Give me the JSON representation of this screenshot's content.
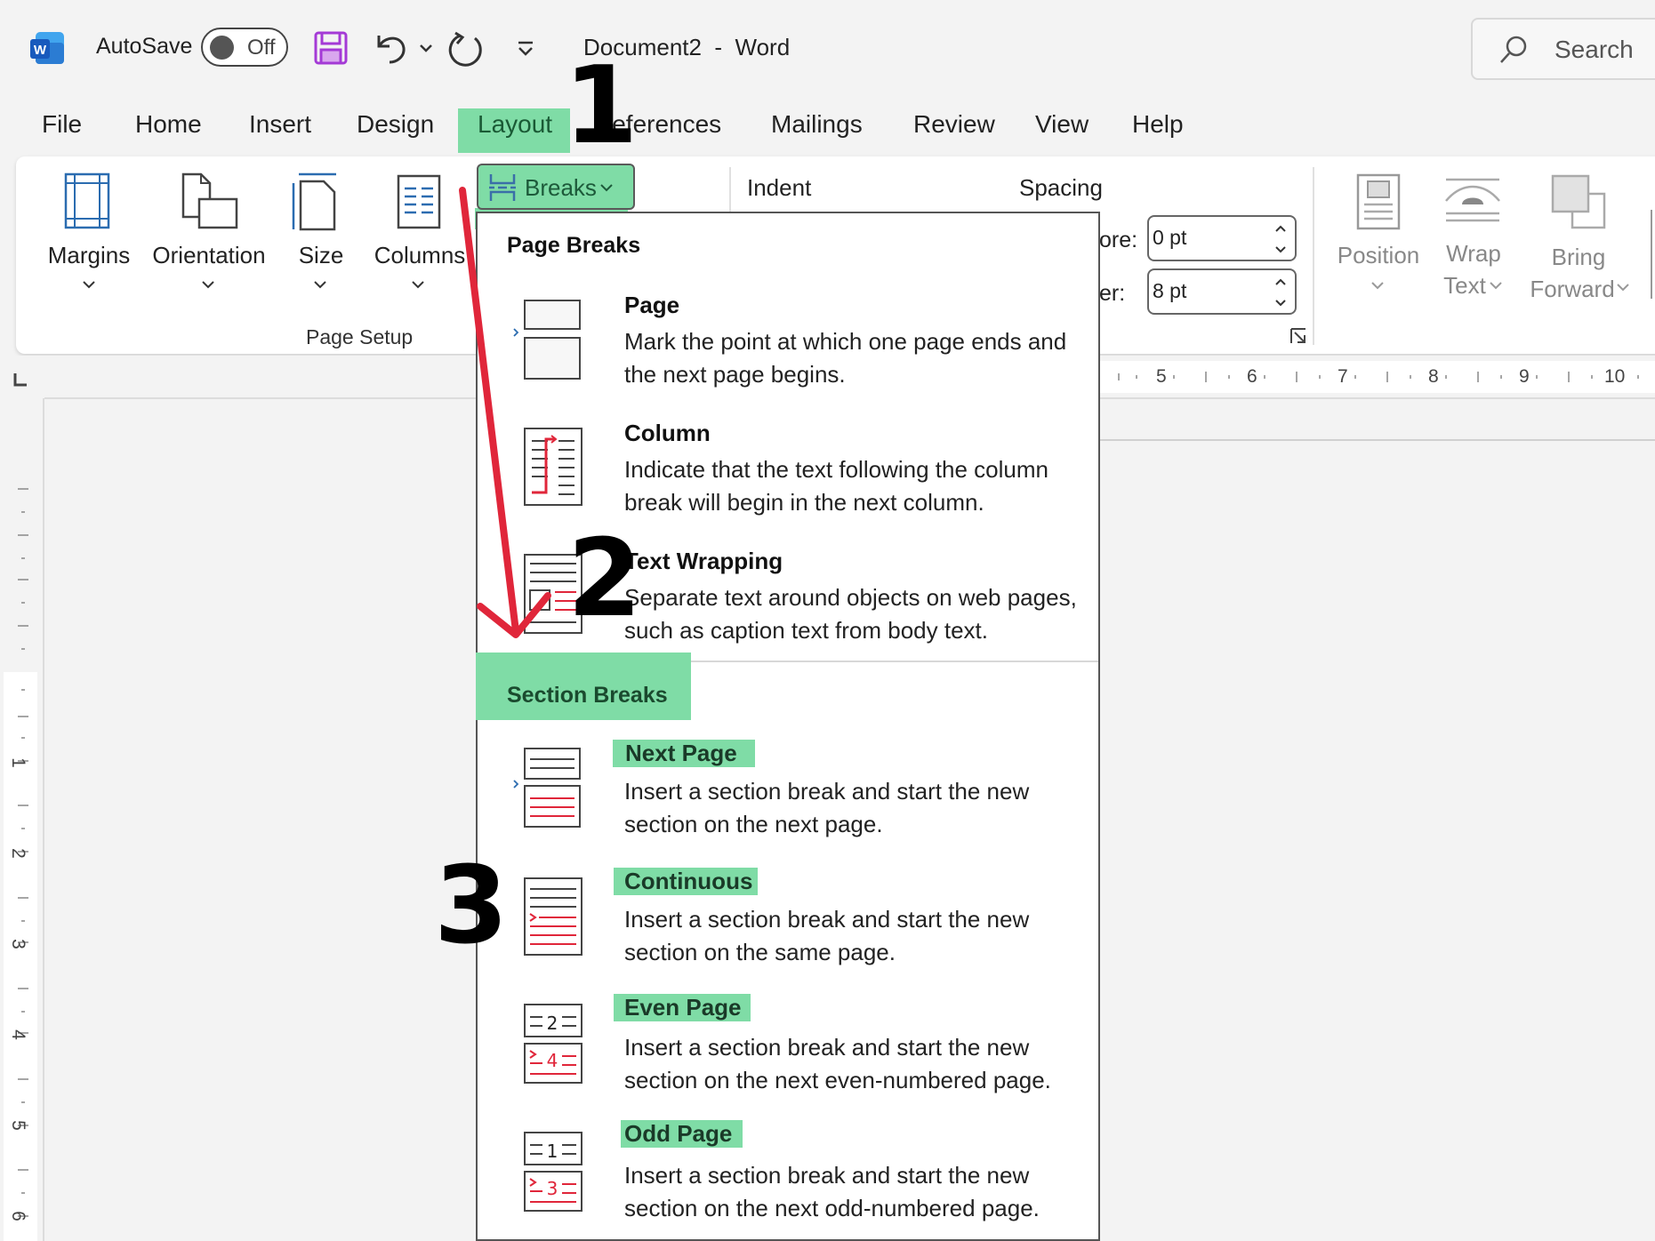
{
  "titlebar": {
    "autosave_label": "AutoSave",
    "autosave_state": "Off",
    "document_title": "Document2  -  Word",
    "search_label": "Search"
  },
  "tabs": [
    "File",
    "Home",
    "Insert",
    "Design",
    "Layout",
    "References",
    "Mailings",
    "Review",
    "View",
    "Help"
  ],
  "active_tab": "Layout",
  "ribbon": {
    "page_setup": {
      "buttons": [
        "Margins",
        "Orientation",
        "Size",
        "Columns"
      ],
      "group_label": "Page Setup",
      "breaks_label": "Breaks"
    },
    "paragraph": {
      "indent_label": "Indent",
      "spacing_label": "Spacing",
      "before_label": "ore:",
      "before_value": "0 pt",
      "after_label": "er:",
      "after_value": "8 pt"
    },
    "arrange": {
      "position": "Position",
      "wrap_line1": "Wrap",
      "wrap_line2": "Text",
      "bring_line1": "Bring",
      "bring_line2": "Forward"
    }
  },
  "ruler": {
    "horizontal_numbers": [
      "5",
      "6",
      "7",
      "8",
      "9",
      "10"
    ],
    "vertical_numbers": [
      "1",
      "2",
      "3",
      "4",
      "5",
      "6"
    ]
  },
  "breaks_menu": {
    "page_breaks_title": "Page Breaks",
    "section_breaks_title": "Section Breaks",
    "page_breaks": [
      {
        "title": "Page",
        "desc": "Mark the point at which one page ends and the next page begins."
      },
      {
        "title": "Column",
        "desc": "Indicate that the text following the column break will begin in the next column."
      },
      {
        "title": "Text Wrapping",
        "desc": "Separate text around objects on web pages, such as caption text from body text."
      }
    ],
    "section_breaks": [
      {
        "title": "Next Page",
        "desc": "Insert a section break and start the new section on the next page."
      },
      {
        "title": "Continuous",
        "desc": "Insert a section break and start the new section on the same page."
      },
      {
        "title": "Even Page",
        "desc": "Insert a section break and start the new section on the next even-numbered page."
      },
      {
        "title": "Odd Page",
        "desc": "Insert a section break and start the new section on the next odd-numbered page."
      }
    ],
    "icon_numbers": {
      "even_top": "2",
      "even_bottom": "4",
      "odd_top": "1",
      "odd_bottom": "3"
    }
  },
  "annotations": [
    "1",
    "2",
    "3"
  ],
  "colors": {
    "highlight": "#7fdca6",
    "arrow": "#e0263a",
    "word_blue": "#185abd",
    "save_purple": "#a43ad6"
  }
}
